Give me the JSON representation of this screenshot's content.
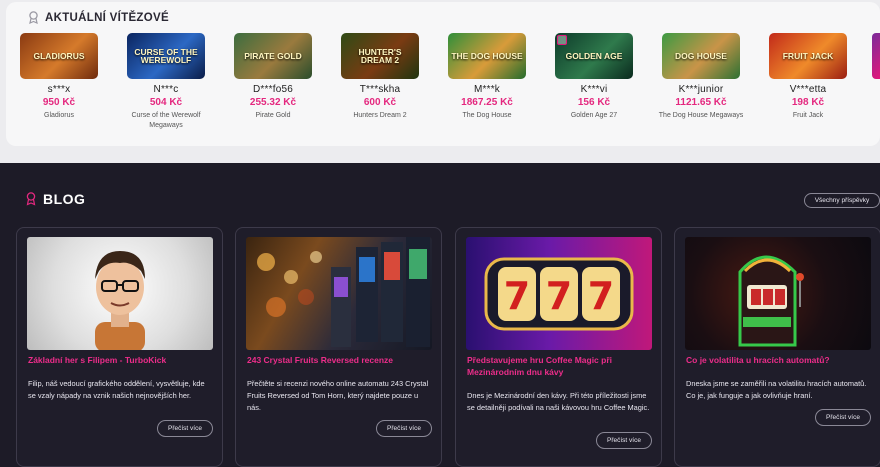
{
  "winners": {
    "title": "AKTUÁLNÍ VÍTĚZOVÉ",
    "items": [
      {
        "thumb": "GLADIORUS",
        "user": "s***x",
        "amount": "950 Kč",
        "game": "Gladiorus"
      },
      {
        "thumb": "CURSE OF THE WEREWOLF",
        "user": "N***c",
        "amount": "504 Kč",
        "game": "Curse of the Werewolf Megaways"
      },
      {
        "thumb": "PIRATE GOLD",
        "user": "D***fo56",
        "amount": "255.32 Kč",
        "game": "Pirate Gold"
      },
      {
        "thumb": "HUNTER'S DREAM 2",
        "user": "T***skha",
        "amount": "600 Kč",
        "game": "Hunters Dream 2"
      },
      {
        "thumb": "THE DOG HOUSE",
        "user": "M***k",
        "amount": "1867.25 Kč",
        "game": "The Dog House"
      },
      {
        "thumb": "GOLDEN AGE",
        "user": "K***vi",
        "amount": "156 Kč",
        "game": "Golden Age 27"
      },
      {
        "thumb": "DOG HOUSE",
        "user": "K***junior",
        "amount": "1121.65 Kč",
        "game": "The Dog House Megaways"
      },
      {
        "thumb": "FRUIT JACK",
        "user": "V***etta",
        "amount": "198 Kč",
        "game": "Fruit Jack"
      }
    ]
  },
  "blog": {
    "title": "BLOG",
    "all_label": "Všechny příspěvky",
    "more_label": "Přečíst více",
    "posts": [
      {
        "title": "Základní her s Filipem - TurboKick",
        "text": "Filip, náš vedoucí grafického oddělení, vysvětluje, kde se vzaly nápady na vznik našich nejnovějších her."
      },
      {
        "title": "243 Crystal Fruits Reversed recenze",
        "text": "Přečtěte si recenzi nového online automatu 243 Crystal Fruits Reversed od Tom Horn, který najdete pouze u nás."
      },
      {
        "title": "Představujeme hru Coffee Magic při Mezinárodním dnu kávy",
        "text": "Dnes je Mezinárodní den kávy. Při této příležitosti jsme se detailněji podívali na naši kávovou hru Coffee Magic."
      },
      {
        "title": "Co je volatilita u hracích automatů?",
        "text": "Dneska jsme se zaměřili na volatilitu hracích automatů. Co je, jak funguje a jak ovlivňuje hraní."
      }
    ]
  },
  "colors": {
    "accent": "#e4287f",
    "background": "#1d1b27"
  }
}
